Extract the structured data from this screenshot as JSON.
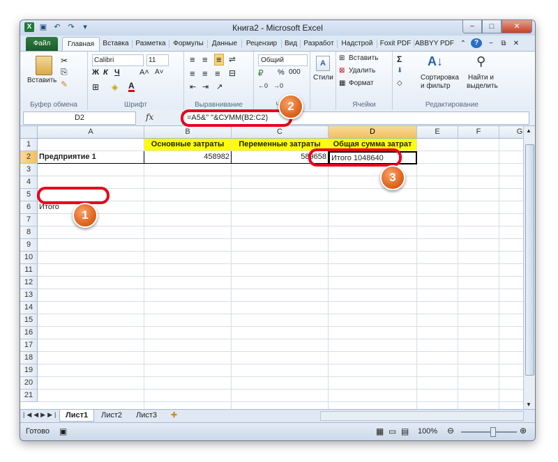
{
  "window": {
    "title": "Книга2 - Microsoft Excel",
    "app_icon": "X",
    "minimize": "−",
    "restore": "□",
    "close": "✕"
  },
  "ribbon_tabs": [
    "Файл",
    "Главная",
    "Вставка",
    "Разметка",
    "Формулы",
    "Данные",
    "Рецензир",
    "Вид",
    "Разработ",
    "Надстрой",
    "Foxit PDF",
    "ABBYY PDF"
  ],
  "ribbon": {
    "paste": "Вставить",
    "clipboard_group": "Буфер обмена",
    "font_name": "Calibri",
    "font_size": "11",
    "bold": "Ж",
    "italic": "К",
    "underline": "Ч",
    "grow_font": "A˄",
    "shrink_font": "A˅",
    "font_group": "Шрифт",
    "alignment_group": "Выравнивание",
    "number_format": "Общий",
    "percent": "%",
    "thousands": "000",
    "number_group": "Чис",
    "styles": "Стили",
    "insert_cells": "Вставить",
    "delete_cells": "Удалить",
    "format_cells": "Формат",
    "cells_group": "Ячейки",
    "sum": "Σ",
    "sort_filter_1": "Сортировка",
    "sort_filter_2": "и фильтр",
    "find_1": "Найти и",
    "find_2": "выделить",
    "editing_group": "Редактирование"
  },
  "formula_bar": {
    "name_box": "D2",
    "fx": "fx",
    "formula": "=A5&\" \"&СУММ(B2:C2)"
  },
  "columns": [
    "A",
    "B",
    "C",
    "D",
    "E",
    "F",
    "G"
  ],
  "rows": [
    "1",
    "2",
    "3",
    "4",
    "5",
    "6",
    "7",
    "8",
    "9",
    "10",
    "11",
    "12",
    "13",
    "14",
    "15",
    "16",
    "17",
    "18",
    "19",
    "20",
    "21"
  ],
  "cells": {
    "B1": "Основные затраты",
    "C1": "Переменные затраты",
    "D1": "Общая сумма затрат",
    "A2": "Предприятие 1",
    "B2": "458982",
    "C2": "589658",
    "D2": "Итого 1048640",
    "A5": "Итого"
  },
  "sheets": [
    "Лист1",
    "Лист2",
    "Лист3"
  ],
  "status": {
    "ready": "Готово",
    "zoom": "100%"
  },
  "callouts": [
    "1",
    "2",
    "3"
  ],
  "colors": {
    "header_fill": "#ffff00",
    "callout_ring": "#e8001c",
    "callout_badge": "#e0661e",
    "file_tab": "#1f7a3a"
  }
}
